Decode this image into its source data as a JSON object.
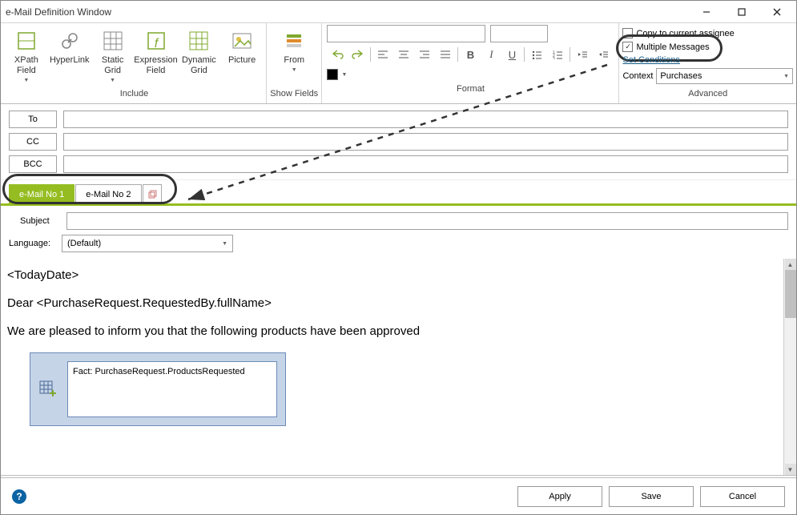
{
  "title": "e-Mail Definition Window",
  "ribbon": {
    "include": {
      "label": "Include",
      "xpath": "XPath\nField",
      "hyperlink": "HyperLink",
      "staticgrid": "Static\nGrid",
      "exprfield": "Expression\nField",
      "dyngrid": "Dynamic\nGrid",
      "picture": "Picture"
    },
    "showfields": {
      "label": "Show Fields",
      "from": "From"
    },
    "format": {
      "label": "Format"
    },
    "advanced": {
      "label": "Advanced",
      "copy_assignee": "Copy to current assignee",
      "multiple_messages": "Multiple Messages",
      "set_conditions": "Set Conditions",
      "context_label": "Context",
      "context_value": "Purchases"
    }
  },
  "fields": {
    "to_label": "To",
    "cc_label": "CC",
    "bcc_label": "BCC",
    "to": "",
    "cc": "",
    "bcc": ""
  },
  "tabs": {
    "tab1": "e-Mail No  1",
    "tab2": "e-Mail No  2"
  },
  "subject": {
    "label": "Subject",
    "value": ""
  },
  "language": {
    "label": "Language:",
    "value": "(Default)"
  },
  "body": {
    "line1": "<TodayDate>",
    "line2": "Dear <PurchaseRequest.RequestedBy.fullName>",
    "line3": "We are pleased to inform you that the following products have been approved",
    "fact": "Fact: PurchaseRequest.ProductsRequested"
  },
  "footer": {
    "apply": "Apply",
    "save": "Save",
    "cancel": "Cancel"
  }
}
